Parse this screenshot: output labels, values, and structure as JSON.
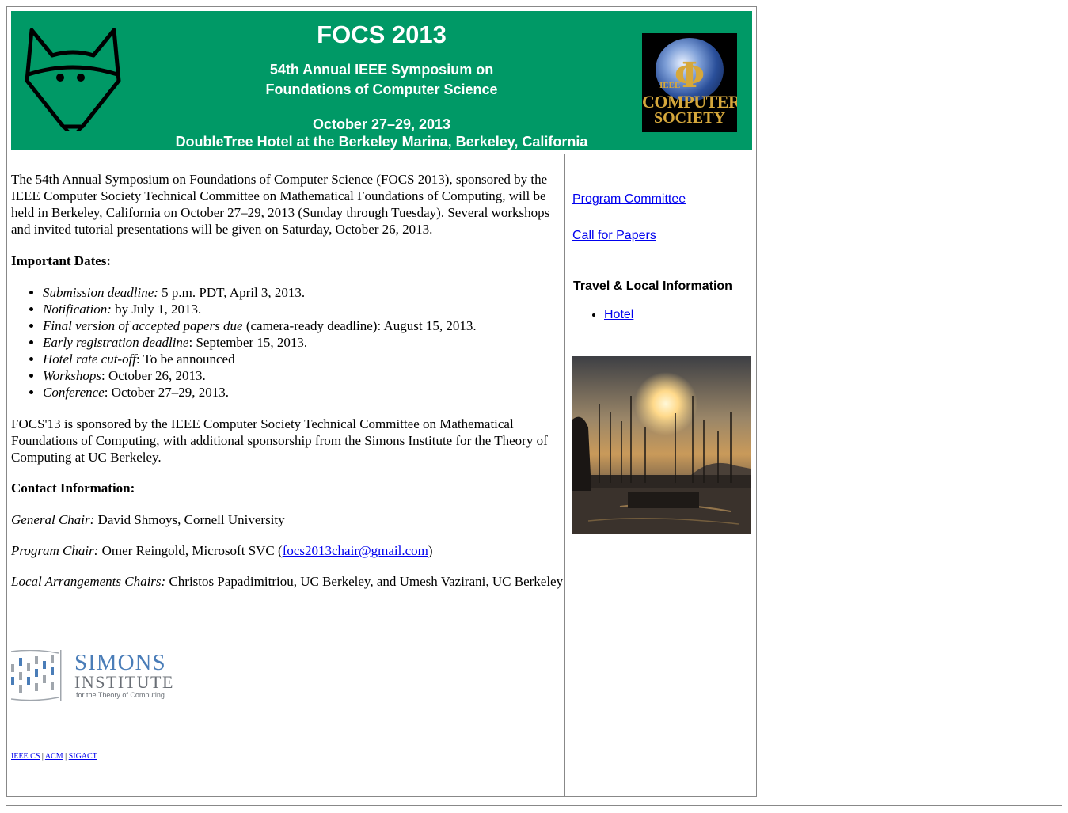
{
  "header": {
    "title": "FOCS 2013",
    "subtitle_line1": "54th Annual IEEE Symposium on",
    "subtitle_line2": "Foundations of Computer Science",
    "dates": "October 27–29, 2013",
    "venue": "DoubleTree Hotel at the Berkeley Marina, Berkeley, California",
    "cs_logo": {
      "small": "IEEE",
      "line1": "COMPUTER",
      "line2": "SOCIETY",
      "symbol": "Φ"
    },
    "bg_color": "#009966"
  },
  "main": {
    "intro": "The 54th Annual Symposium on Foundations of Computer Science (FOCS 2013), sponsored by the IEEE Computer Society Technical Committee on Mathematical Foundations of Computing, will be held in Berkeley, California on October 27–29, 2013 (Sunday through Tuesday). Several workshops and invited tutorial presentations will be given on Saturday, October 26, 2013.",
    "dates_heading": "Important Dates:",
    "dates": [
      {
        "label": "Submission deadline:",
        "value": " 5 p.m. PDT, April 3, 2013."
      },
      {
        "label": "Notification:",
        "value": " by July 1, 2013."
      },
      {
        "label": "Final version of accepted papers due",
        "value": " (camera-ready deadline): August 15, 2013."
      },
      {
        "label": "Early registration deadline",
        "value": ": September 15, 2013."
      },
      {
        "label": "Hotel rate cut-off",
        "value": ": To be announced"
      },
      {
        "label": "Workshops",
        "value": ": October 26, 2013."
      },
      {
        "label": "Conference",
        "value": ": October 27–29, 2013."
      }
    ],
    "sponsor_text": "FOCS'13 is sponsored by the IEEE Computer Society Technical Committee on Mathematical Foundations of Computing, with additional sponsorship from the Simons Institute for the Theory of Computing at UC Berkeley.",
    "contact_heading": "Contact Information:",
    "general_chair_label": "General Chair:",
    "general_chair": " David Shmoys, Cornell University",
    "program_chair_label": "Program Chair:",
    "program_chair": " Omer Reingold, Microsoft SVC (",
    "program_chair_email": "focs2013chair@gmail.com",
    "program_chair_close": ")",
    "local_chairs_label": "Local Arrangements Chairs:",
    "local_chairs": " Christos Papadimitriou, UC Berkeley, and Umesh Vazirani, UC Berkeley"
  },
  "simons": {
    "line1": "SIMONS",
    "line2": "INSTITUTE",
    "line3": "for the Theory of Computing"
  },
  "footer_links": [
    {
      "label": "IEEE CS"
    },
    {
      "label": "ACM"
    },
    {
      "label": "SIGACT"
    }
  ],
  "footer_sep": "|",
  "sidebar": {
    "program_committee": "Program Committee",
    "call_for_papers": "Call for Papers",
    "travel_heading": "Travel & Local Information",
    "hotel": "Hotel"
  }
}
